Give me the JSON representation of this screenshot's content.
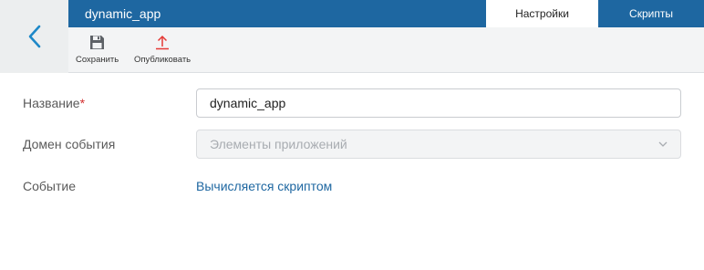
{
  "header": {
    "app_title": "dynamic_app",
    "tabs": [
      {
        "label": "Настройки",
        "active": true
      },
      {
        "label": "Скрипты",
        "active": false
      }
    ]
  },
  "toolbar": {
    "save_label": "Сохранить",
    "publish_label": "Опубликовать"
  },
  "form": {
    "name": {
      "label": "Название",
      "required_mark": "*",
      "value": "dynamic_app"
    },
    "event_domain": {
      "label": "Домен события",
      "value": "Элементы приложений"
    },
    "event": {
      "label": "Событие",
      "value": "Вычисляется скриптом"
    }
  },
  "icons": {
    "back": "chevron-left-icon",
    "save": "floppy-disk-icon",
    "publish": "upload-arrow-icon",
    "select": "chevron-down-icon"
  },
  "colors": {
    "brand": "#1e67a1",
    "publish_icon": "#e53935",
    "required": "#d32f2f",
    "link": "#1e67a1"
  }
}
